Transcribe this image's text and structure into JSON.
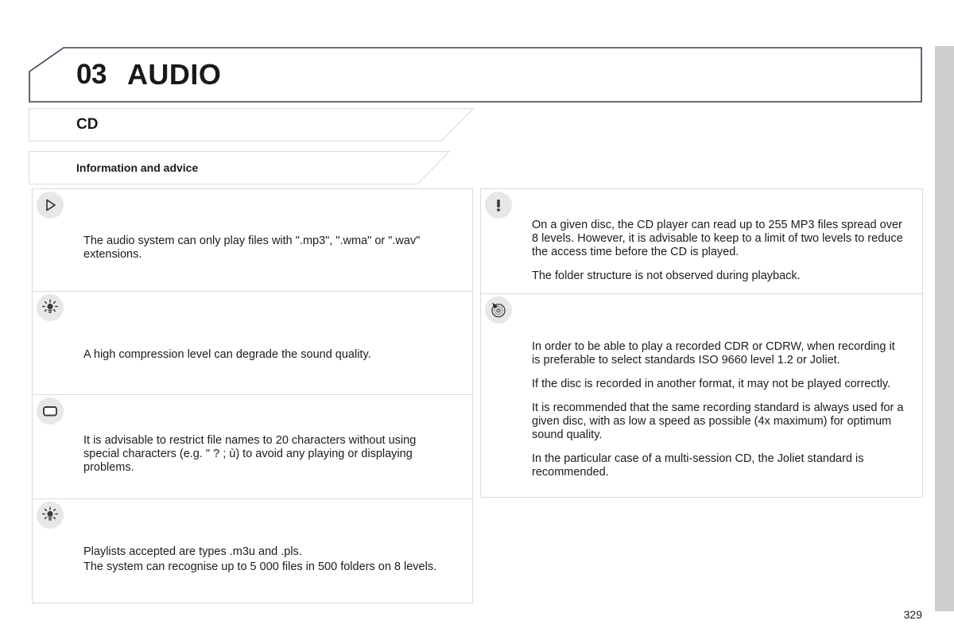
{
  "document": {
    "page_number": "329"
  },
  "chapter": {
    "number": "03",
    "name": "AUDIO"
  },
  "section": {
    "title": "CD"
  },
  "subsection": {
    "title": "Information and advice"
  },
  "colors": {
    "chapter_border": "#2e4159",
    "banner_border": "#d9dadc",
    "icon_bg": "#e7e7e8",
    "edge_tab": "#ccced0",
    "text": "#1c1c1c"
  },
  "left_column": [
    {
      "icon": "play-triangle-icon",
      "paragraphs": [
        "The audio system can only play files with \".mp3\", \".wma\" or \".wav\" extensions."
      ]
    },
    {
      "icon": "lightbulb-tip-icon",
      "paragraphs": [
        "A high compression level can degrade the sound quality."
      ]
    },
    {
      "icon": "display-screen-icon",
      "paragraphs": [
        "It is advisable to restrict file names to 20 characters without using special characters (e.g. \" ? ; ù) to avoid any playing or displaying problems."
      ]
    },
    {
      "icon": "lightbulb-tip-icon",
      "paragraphs": [
        "Playlists accepted are types .m3u and .pls.",
        "The system can recognise up to 5 000 files in 500 folders on 8 levels."
      ]
    }
  ],
  "right_column": [
    {
      "icon": "warning-exclamation-icon",
      "paragraphs": [
        "On a given disc, the CD player can read up to 255 MP3 files spread over 8 levels. However, it is advisable to keep to a limit of two levels to reduce the access time before the CD is played.",
        "The folder structure is not observed during playback."
      ]
    },
    {
      "icon": "cd-disc-icon",
      "paragraphs": [
        "In order to be able to play a recorded CDR or CDRW, when recording it is preferable to select standards ISO 9660 level 1.2 or Joliet.",
        "If the disc is recorded in another format, it may not be played correctly.",
        "It is recommended that the same recording standard is always used for a given disc, with as low a speed as possible (4x maximum) for optimum sound quality.",
        "In the particular case of a multi-session CD, the Joliet standard is recommended."
      ]
    }
  ]
}
